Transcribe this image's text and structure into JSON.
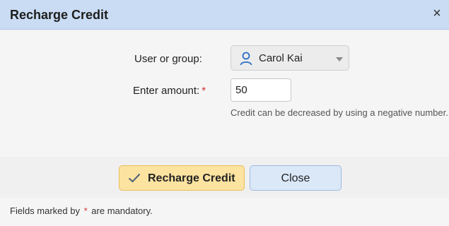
{
  "dialog": {
    "title": "Recharge Credit",
    "close_glyph": "×"
  },
  "form": {
    "user_label": "User or group:",
    "user_value": "Carol Kai",
    "user_icon": "user-icon",
    "amount_label": "Enter amount:",
    "required_marker": "*",
    "amount_value": "50",
    "hint": "Credit can be decreased by using a negative number."
  },
  "buttons": {
    "recharge_label": "Recharge Credit",
    "close_label": "Close"
  },
  "footer": {
    "note_prefix": "Fields marked by",
    "note_marker": "*",
    "note_suffix": "are mandatory."
  },
  "colors": {
    "titlebar": "#c9dcf3",
    "primary_button": "#fde3a0",
    "secondary_button": "#dbe8f8",
    "required": "#d03030",
    "user_icon": "#2f6fc4"
  }
}
